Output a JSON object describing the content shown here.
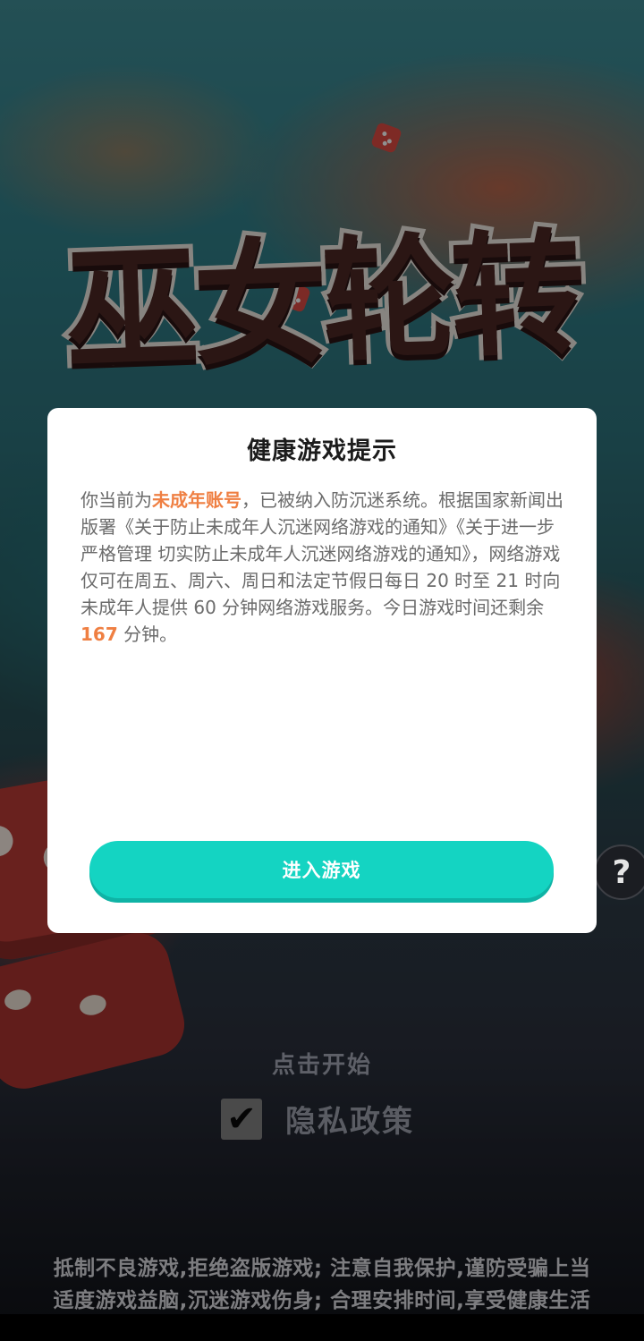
{
  "game": {
    "title_art": "巫女轮转",
    "start_hint": "点击开始",
    "privacy": {
      "checked": true,
      "check_glyph": "✔",
      "label": "隐私政策"
    },
    "help_glyph": "?",
    "advisory_lines": [
      "抵制不良游戏,拒绝盗版游戏; 注意自我保护,谨防受骗上当",
      "适度游戏益脑,沉迷游戏伤身; 合理安排时间,享受健康生活"
    ]
  },
  "dialog": {
    "title": "健康游戏提示",
    "body": {
      "part1": "你当前为",
      "account_type": "未成年账号",
      "part2": "，已被纳入防沉迷系统。根据国家新闻出版署《关于防止未成年人沉迷网络游戏的通知》《关于进一步严格管理 切实防止未成年人沉迷网络游戏的通知》，网络游戏仅可在周五、周六、周日和法定节假日每日 20 时至 21 时向未成年人提供 60 分钟网络游戏服务。今日游戏时间还剩余 ",
      "remaining_minutes": "167",
      "part3": " 分钟。"
    },
    "button_label": "进入游戏"
  },
  "colors": {
    "accent_button": "#14d4c2",
    "highlight_text": "#ef7f42"
  }
}
